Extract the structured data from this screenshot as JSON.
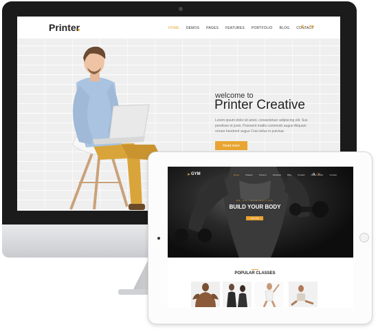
{
  "desktop": {
    "logo": "Printer",
    "nav": {
      "items": [
        "HOME",
        "DEMOS",
        "PAGES",
        "FEATURES",
        "PORTFOLIO",
        "BLOG",
        "CONTACT"
      ],
      "active": "HOME"
    },
    "hero": {
      "welcome": "welcome to",
      "title": "Printer Creative",
      "description": "Lorem ipsum dolor sit amet, consectetuer adipiscing elit. Sus pendisse et justo. Praesent mattis commodo augue Aliquam ornare hendrerit augue Cras tellus in pulvinar.",
      "button": "Read more"
    }
  },
  "tablet": {
    "logo": "GYM",
    "nav": {
      "items": [
        "Home",
        "Classes",
        "Trainers",
        "Schedule",
        "Blog",
        "Contact",
        "Store Locator",
        "Contact"
      ],
      "active": "Home"
    },
    "hero": {
      "kicker": "BE AN INSPIRATION",
      "headline": "BUILD YOUR BODY",
      "button": "JOIN NOW"
    },
    "classes_title": "POPULAR CLASSES"
  },
  "colors": {
    "accent": "#e8a532",
    "text_dark": "#222222"
  }
}
